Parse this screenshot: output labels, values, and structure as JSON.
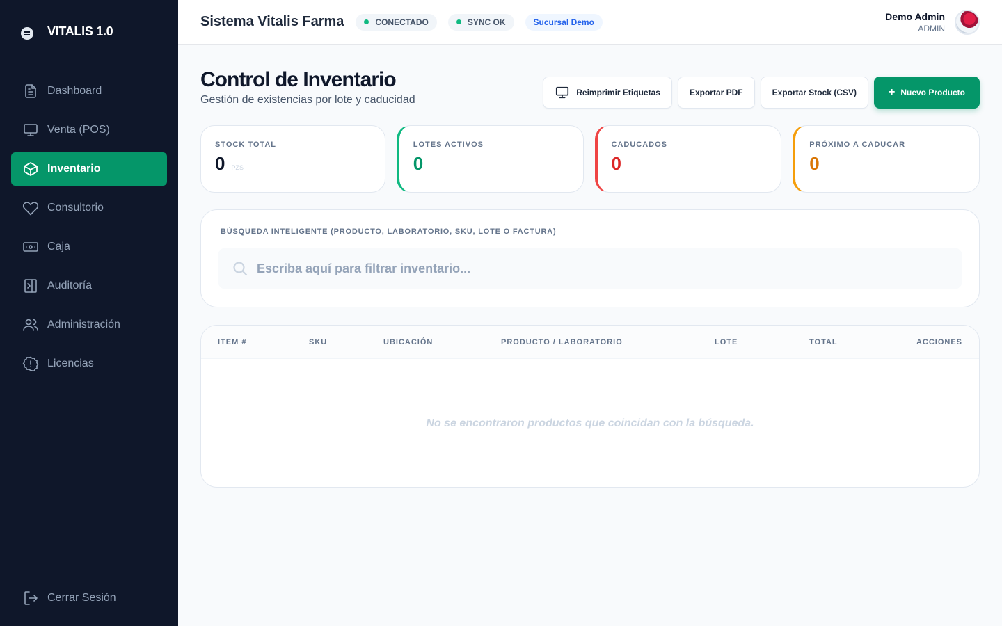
{
  "sidebar": {
    "brand": "VITALIS 1.0",
    "items": [
      {
        "label": "Dashboard",
        "icon": "document-icon"
      },
      {
        "label": "Venta (POS)",
        "icon": "monitor-icon"
      },
      {
        "label": "Inventario",
        "icon": "box-icon"
      },
      {
        "label": "Consultorio",
        "icon": "heart-icon"
      },
      {
        "label": "Caja",
        "icon": "cash-icon"
      },
      {
        "label": "Auditoría",
        "icon": "panel-icon"
      },
      {
        "label": "Administración",
        "icon": "users-icon"
      },
      {
        "label": "Licencias",
        "icon": "alert-icon"
      }
    ],
    "active_item": "Inventario",
    "logout": "Cerrar Sesión"
  },
  "header": {
    "title": "Sistema Vitalis Farma",
    "status_connected": "CONECTADO",
    "status_sync": "SYNC OK",
    "branch": "Sucursal Demo",
    "user_name": "Demo Admin",
    "user_role": "ADMIN"
  },
  "page": {
    "title": "Control de Inventario",
    "subtitle": "Gestión de existencias por lote y caducidad"
  },
  "actions": {
    "reprint": "Reimprimir Etiquetas",
    "export_pdf": "Exportar PDF",
    "export_csv": "Exportar Stock (CSV)",
    "new_product": "Nuevo Producto"
  },
  "stats": {
    "stock_total": {
      "label": "STOCK TOTAL",
      "value": "0",
      "unit": "PZS"
    },
    "active_lots": {
      "label": "LOTES ACTIVOS",
      "value": "0"
    },
    "expired": {
      "label": "CADUCADOS",
      "value": "0"
    },
    "expiring": {
      "label": "PRÓXIMO A CADUCAR",
      "value": "0"
    }
  },
  "search": {
    "label": "BÚSQUEDA INTELIGENTE (PRODUCTO, LABORATORIO, SKU, LOTE O FACTURA)",
    "placeholder": "Escriba aquí para filtrar inventario..."
  },
  "table": {
    "columns": [
      "ITEM #",
      "SKU",
      "UBICACIÓN",
      "PRODUCTO / LABORATORIO",
      "LOTE",
      "TOTAL",
      "ACCIONES"
    ],
    "rows": [],
    "empty_message": "No se encontraron productos que coincidan con la búsqueda."
  },
  "colors": {
    "sidebar_bg": "#0f172a",
    "accent": "#059669",
    "danger": "#dc2626",
    "warning": "#d97706",
    "info": "#2563eb"
  }
}
